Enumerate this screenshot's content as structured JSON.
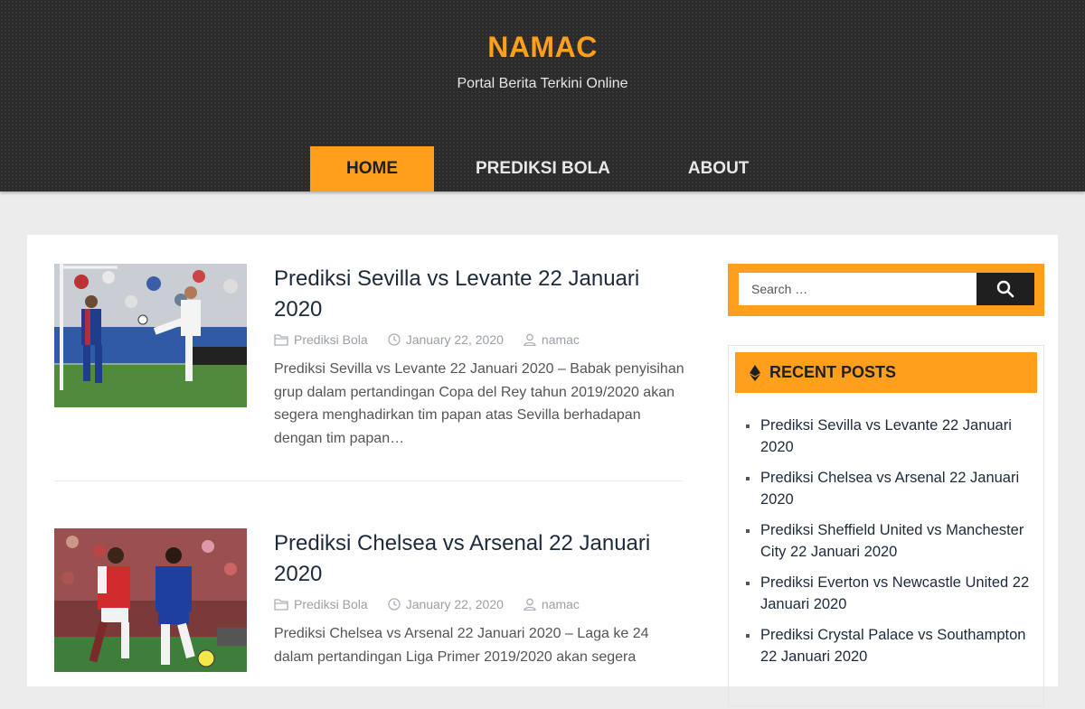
{
  "header": {
    "site_title": "NAMAC",
    "site_description": "Portal Berita Terkini Online"
  },
  "nav": {
    "items": [
      {
        "label": "HOME",
        "active": true
      },
      {
        "label": "PREDIKSI BOLA",
        "active": false
      },
      {
        "label": "ABOUT",
        "active": false
      }
    ]
  },
  "posts": [
    {
      "title": "Prediksi Sevilla vs Levante 22 Januari 2020",
      "category": "Prediksi Bola",
      "date": "January 22, 2020",
      "author": "namac",
      "excerpt": "Prediksi Sevilla vs Levante 22 Januari 2020 – Babak penyisihan grup dalam pertandingan Copa del Rey tahun 2019/2020 akan segera menghadirkan tim papan atas Sevilla berhadapan dengan tim papan…"
    },
    {
      "title": "Prediksi Chelsea vs Arsenal 22 Januari 2020",
      "category": "Prediksi Bola",
      "date": "January 22, 2020",
      "author": "namac",
      "excerpt": "Prediksi Chelsea vs Arsenal 22 Januari 2020 – Laga ke 24 dalam pertandingan Liga Primer 2019/2020 akan segera"
    }
  ],
  "sidebar": {
    "search": {
      "placeholder": "Search …"
    },
    "recent_posts": {
      "title": "RECENT POSTS",
      "items": [
        "Prediksi Sevilla vs Levante 22 Januari 2020",
        "Prediksi Chelsea vs Arsenal 22 Januari 2020",
        "Prediksi Sheffield United vs Manchester City 22 Januari 2020",
        "Prediksi Everton vs Newcastle United 22 Januari 2020",
        "Prediksi Crystal Palace vs Southampton 22 Januari 2020"
      ]
    }
  },
  "colors": {
    "accent": "#ff9f1c",
    "header_bg": "#2b2b2b",
    "page_bg": "#ececec"
  },
  "icons": {
    "category": "folder-icon",
    "date": "clock-icon",
    "author": "user-icon",
    "search": "search-icon",
    "widget": "ethereum-diamond-icon"
  }
}
